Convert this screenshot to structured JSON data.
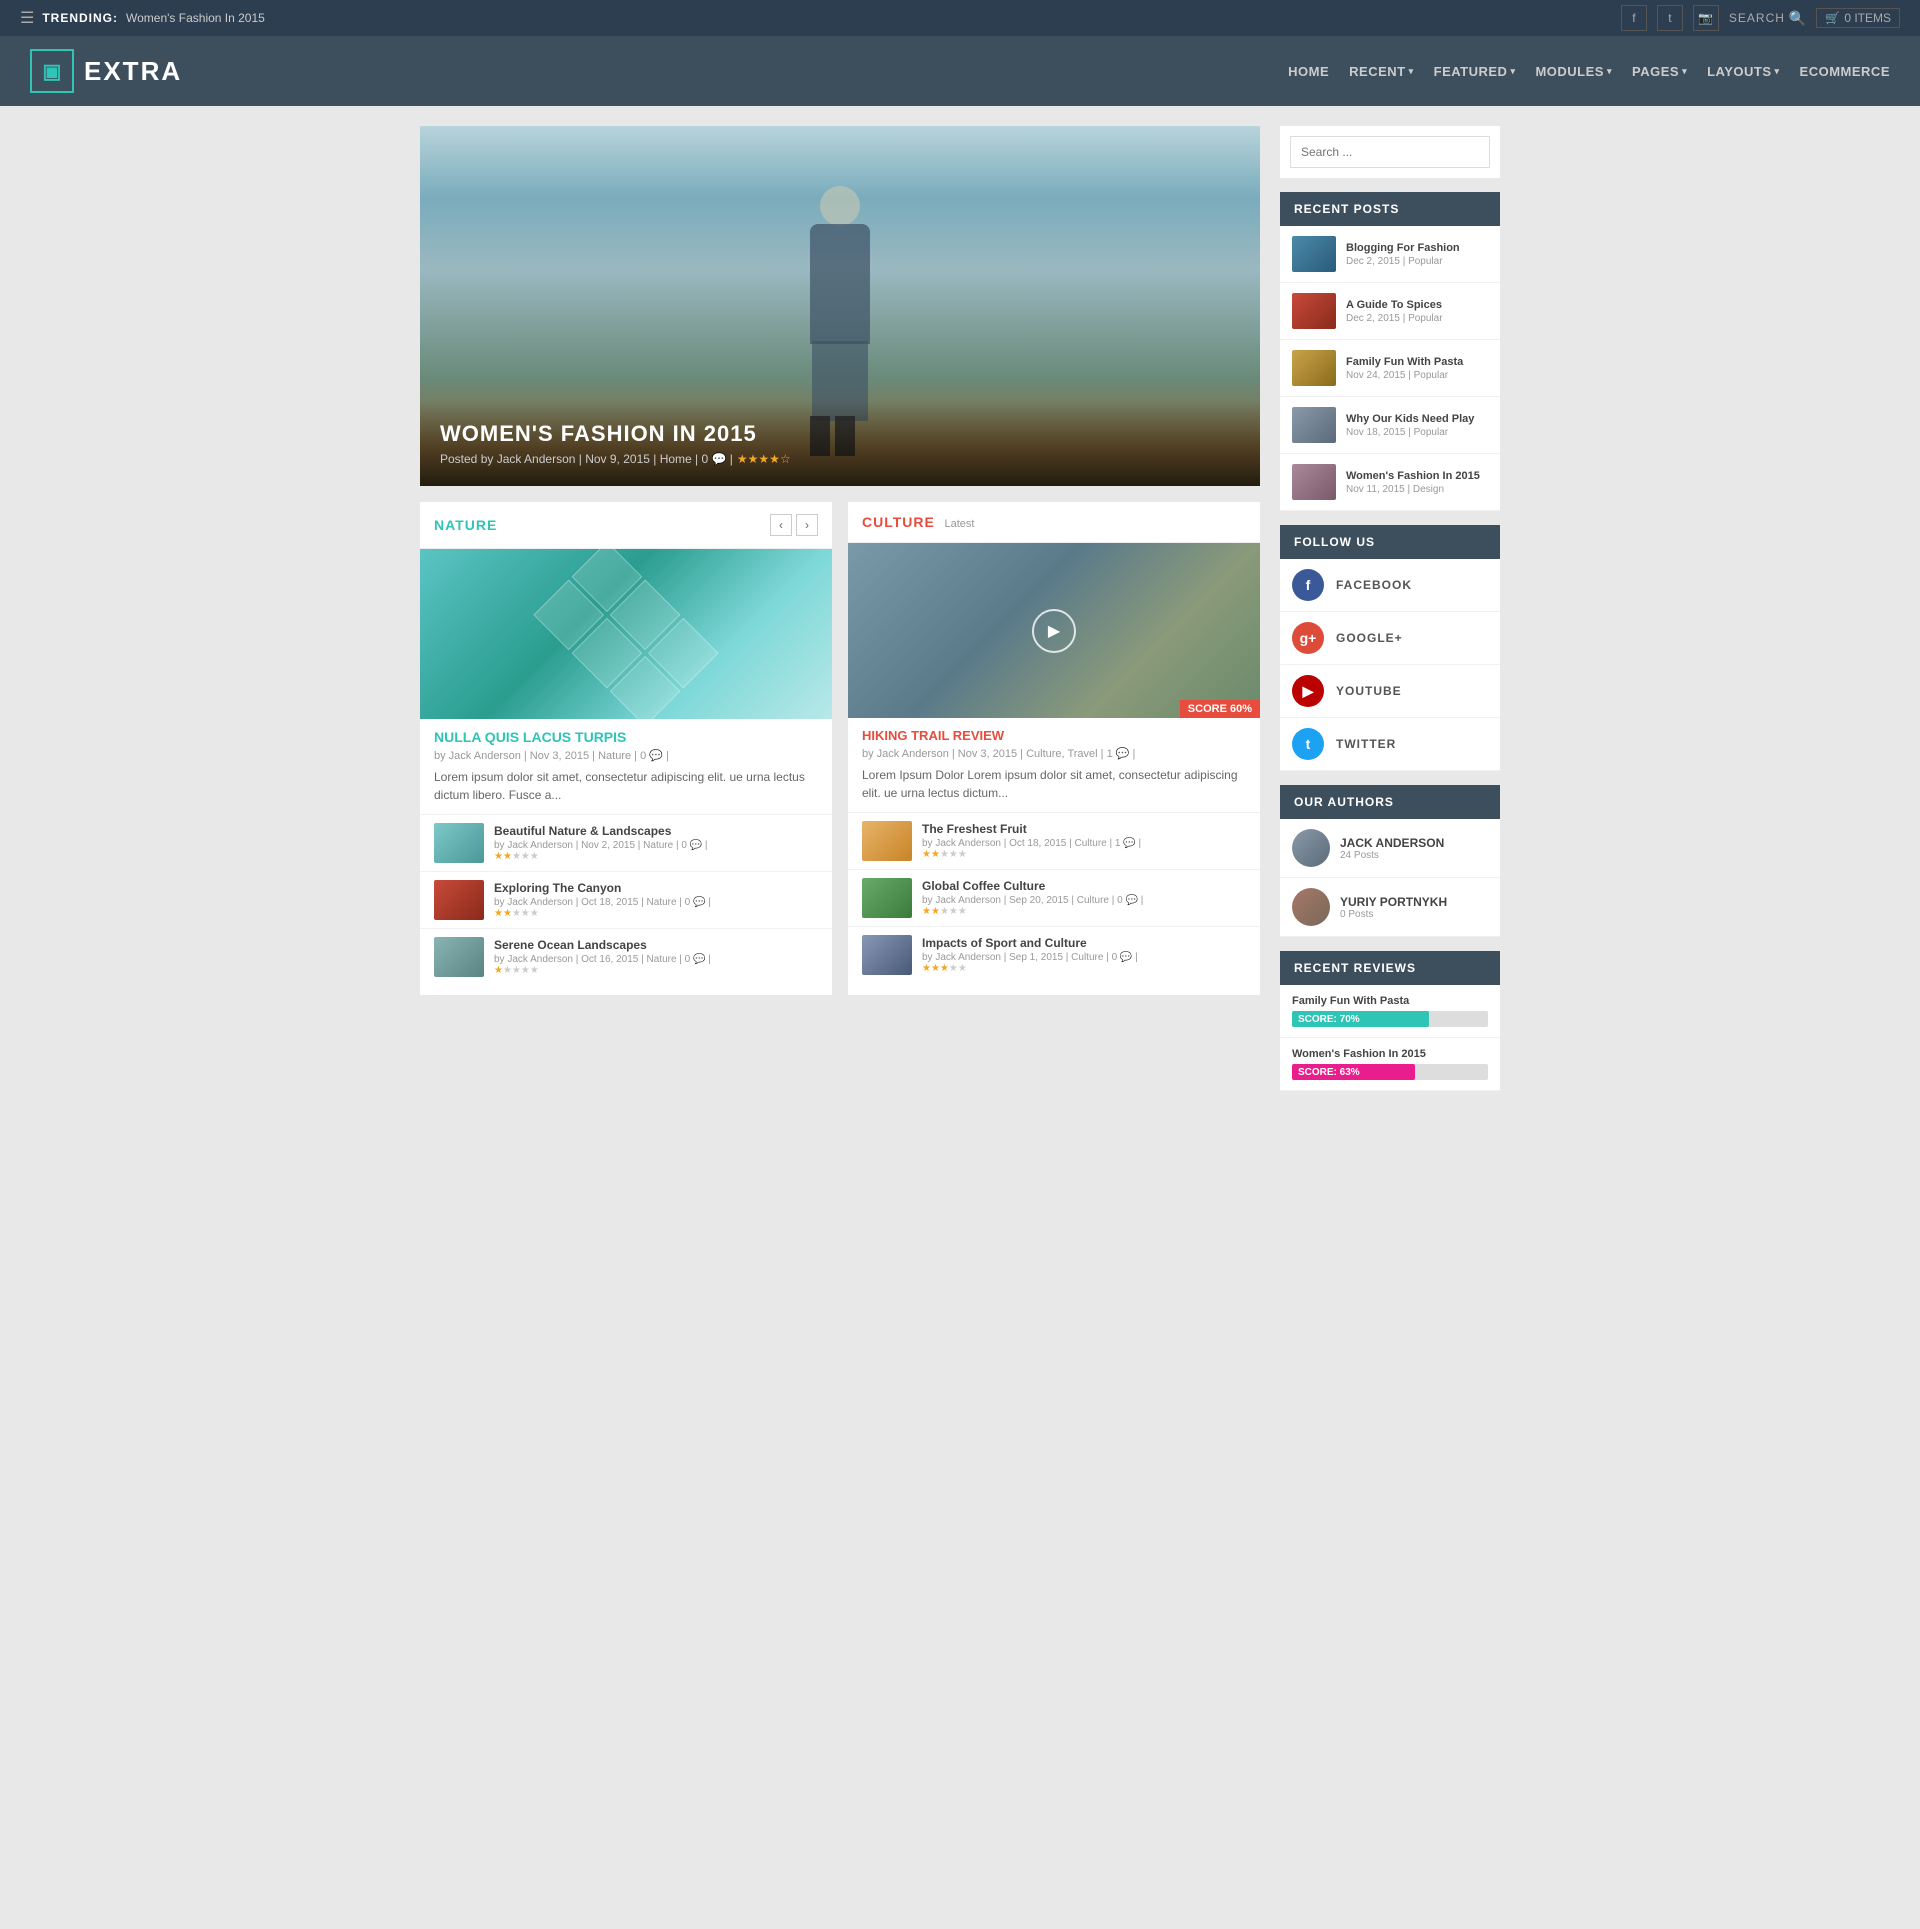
{
  "topbar": {
    "trending_label": "TRENDING:",
    "trending_text": "Women's Fashion In 2015",
    "search_placeholder": "SEARCH",
    "cart_text": "0 ITEMS"
  },
  "header": {
    "logo_text": "EXTRA",
    "nav": [
      {
        "label": "HOME",
        "has_arrow": false
      },
      {
        "label": "RECENT",
        "has_arrow": true
      },
      {
        "label": "FEATURED",
        "has_arrow": true
      },
      {
        "label": "MODULES",
        "has_arrow": true
      },
      {
        "label": "PAGES",
        "has_arrow": true
      },
      {
        "label": "LAYOUTS",
        "has_arrow": true
      },
      {
        "label": "ECOMMERCE",
        "has_arrow": false
      }
    ]
  },
  "hero": {
    "title": "WOMEN'S FASHION IN 2015",
    "meta": "Posted by Jack Anderson | Nov 9, 2015 | Home | 0 💬 |"
  },
  "nature_section": {
    "title": "NATURE",
    "featured": {
      "title": "NULLA QUIS LACUS TURPIS",
      "meta": "by Jack Anderson | Nov 3, 2015 | Nature | 0 💬 |",
      "excerpt": "Lorem ipsum dolor sit amet, consectetur adipiscing elit. ue urna lectus dictum libero. Fusce a..."
    },
    "posts": [
      {
        "title": "Beautiful Nature & Landscapes",
        "meta": "by Jack Anderson | Nov 2, 2015 | Nature | 0 💬 |",
        "thumb_class": "thumb-nature1"
      },
      {
        "title": "Exploring The Canyon",
        "meta": "by Jack Anderson | Oct 18, 2015 | Nature | 0 💬 |",
        "thumb_class": "thumb-nature2"
      },
      {
        "title": "Serene Ocean Landscapes",
        "meta": "by Jack Anderson | Oct 16, 2015 | Nature | 0 💬 |",
        "thumb_class": "thumb-nature3"
      }
    ]
  },
  "culture_section": {
    "title": "CULTURE",
    "badge": "Latest",
    "score": "SCORE 60%",
    "featured": {
      "title": "HIKING TRAIL REVIEW",
      "meta": "by Jack Anderson | Nov 3, 2015 | Culture, Travel | 1 💬 |"
    },
    "excerpt": "Lorem Ipsum Dolor Lorem ipsum dolor sit amet, consectetur adipiscing elit. ue urna lectus dictum...",
    "posts": [
      {
        "title": "The Freshest Fruit",
        "meta": "by Jack Anderson | Oct 18, 2015 | Culture | 1 💬 |",
        "thumb_class": "thumb-culture1"
      },
      {
        "title": "Global Coffee Culture",
        "meta": "by Jack Anderson | Sep 20, 2015 | Culture | 0 💬 |",
        "thumb_class": "thumb-culture2"
      },
      {
        "title": "Impacts of Sport and Culture",
        "meta": "by Jack Anderson | Sep 1, 2015 | Culture | 0 💬 |",
        "thumb_class": "thumb-culture3"
      }
    ]
  },
  "sidebar": {
    "search_placeholder": "Search ...",
    "recent_posts": {
      "header": "RECENT POSTS",
      "items": [
        {
          "title": "Blogging For Fashion",
          "meta": "Dec 2, 2015 | Popular",
          "thumb_class": "rt-fashion"
        },
        {
          "title": "A Guide To Spices",
          "meta": "Dec 2, 2015 | Popular",
          "thumb_class": "rt-spices"
        },
        {
          "title": "Family Fun With Pasta",
          "meta": "Nov 24, 2015 | Popular",
          "thumb_class": "rt-pasta"
        },
        {
          "title": "Why Our Kids Need Play",
          "meta": "Nov 18, 2015 | Popular",
          "thumb_class": "rt-play"
        },
        {
          "title": "Women's Fashion In 2015",
          "meta": "Nov 11, 2015 | Design",
          "thumb_class": "rt-women"
        }
      ]
    },
    "follow_us": {
      "header": "FOLLOW US",
      "items": [
        {
          "label": "FACEBOOK",
          "icon_class": "fi-facebook",
          "icon_char": "f"
        },
        {
          "label": "GOOGLE+",
          "icon_class": "fi-google",
          "icon_char": "g"
        },
        {
          "label": "YOUTUBE",
          "icon_class": "fi-youtube",
          "icon_char": "▶"
        },
        {
          "label": "TWITTER",
          "icon_class": "fi-twitter",
          "icon_char": "t"
        }
      ]
    },
    "authors": {
      "header": "OUR AUTHORS",
      "items": [
        {
          "name": "JACK ANDERSON",
          "posts": "24 Posts",
          "avatar_class": "av-jack"
        },
        {
          "name": "YURIY PORTNYKH",
          "posts": "0 Posts",
          "avatar_class": "av-yuriy"
        }
      ]
    },
    "reviews": {
      "header": "RECENT REVIEWS",
      "items": [
        {
          "title": "Family Fun With Pasta",
          "score": "SCORE: 70%",
          "bar_class": "teal",
          "width": "70%"
        },
        {
          "title": "Women's Fashion In 2015",
          "score": "SCORE: 63%",
          "bar_class": "pink",
          "width": "63%"
        }
      ]
    }
  }
}
